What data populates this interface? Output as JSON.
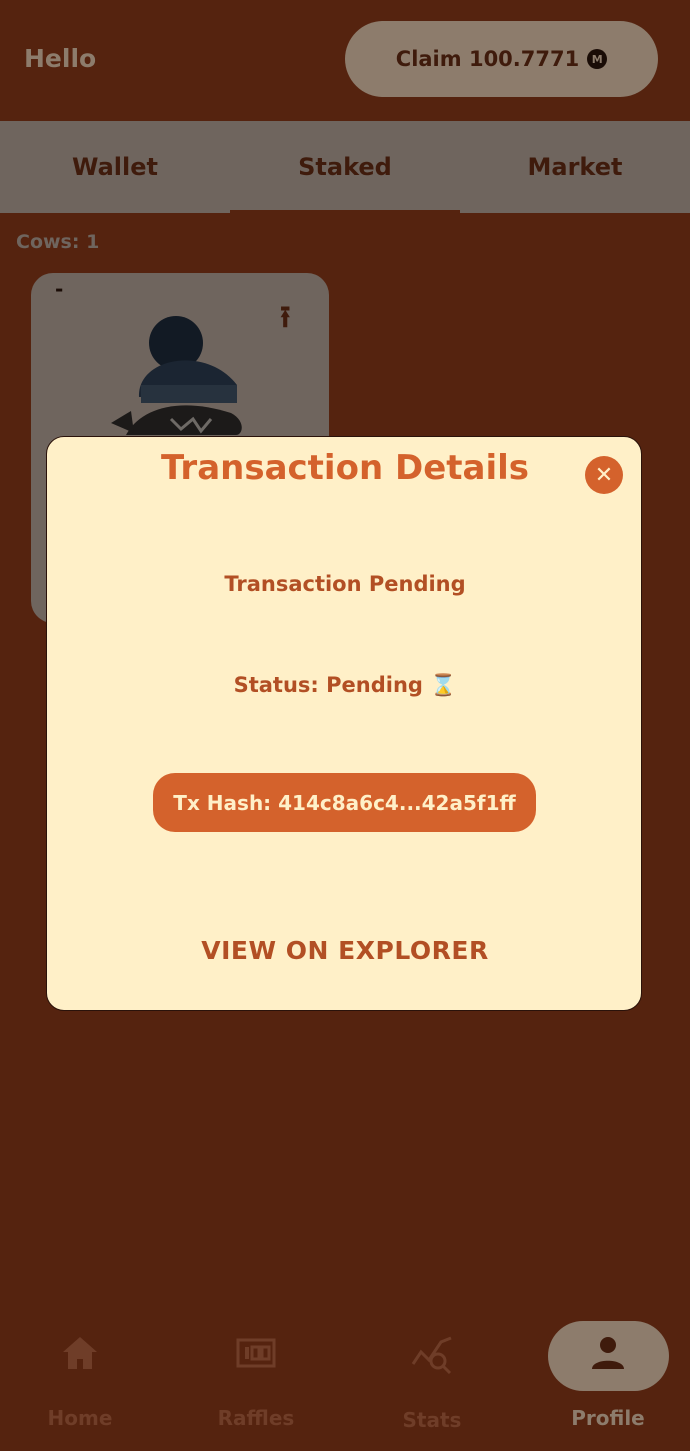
{
  "header": {
    "greeting": "Hello",
    "claim_label": "Claim 100.7771",
    "coin_icon": "coin-icon",
    "coin_glyph": "M"
  },
  "tabs": [
    {
      "label": "Wallet",
      "active": false
    },
    {
      "label": "Staked",
      "active": true
    },
    {
      "label": "Market",
      "active": false
    }
  ],
  "collection": {
    "count_label": "Cows: 1",
    "card_title": "-",
    "card_icon": "upload-arrow-icon",
    "card_icon_glyph": "⭱"
  },
  "modal": {
    "title": "Transaction Details",
    "close_icon": "close-icon",
    "close_glyph": "✕",
    "pending_text": "Transaction Pending",
    "status_text": "Status: Pending ⌛",
    "tx_hash_label": "Tx Hash: 414c8a6c4...42a5f1ff",
    "explorer_label": "VIEW ON EXPLORER"
  },
  "nav": [
    {
      "label": "Home",
      "icon": "home-icon"
    },
    {
      "label": "Raffles",
      "icon": "ticket-icon"
    },
    {
      "label": "Stats",
      "icon": "chart-search-icon"
    },
    {
      "label": "Profile",
      "icon": "user-icon",
      "active": true
    }
  ],
  "colors": {
    "background": "#55230f",
    "modal_background": "#fff0c8",
    "accent": "#d4622c",
    "muted": "#8d7c6c"
  }
}
